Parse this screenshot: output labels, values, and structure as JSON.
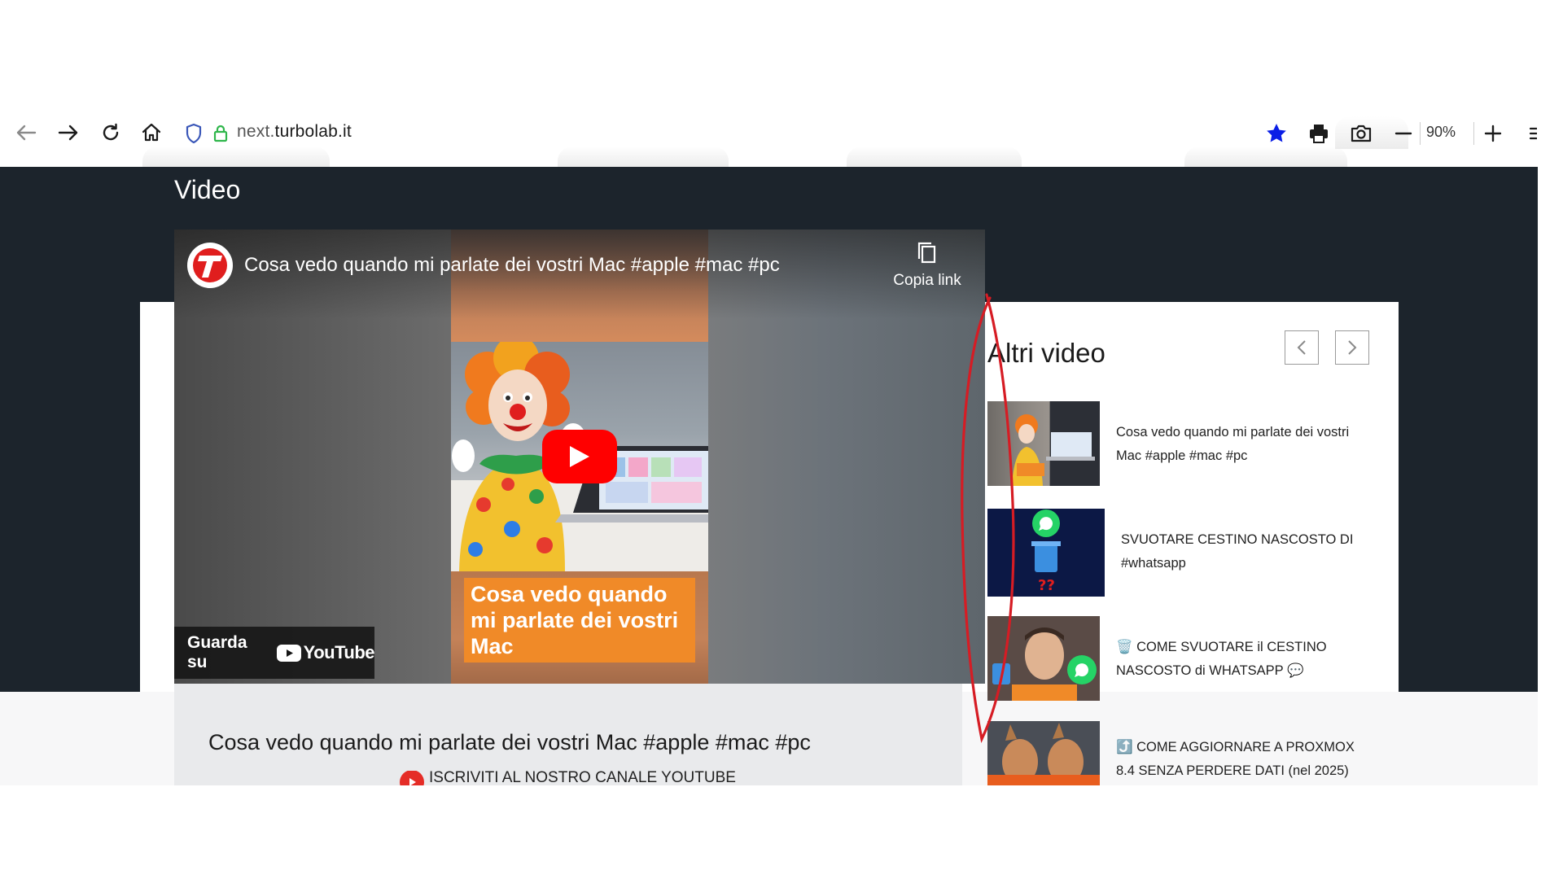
{
  "browser": {
    "url_sub": "next.",
    "url_domain": "turbolab.it",
    "zoom": "90%"
  },
  "page": {
    "section_heading": "Video",
    "player": {
      "title": "Cosa vedo quando mi parlate dei vostri Mac #apple #mac #pc",
      "copy_link_label": "Copia link",
      "thumbnail_caption": "Cosa vedo quando mi parlate dei vostri Mac",
      "watch_on_label": "Guarda su",
      "youtube_word": "YouTube"
    },
    "below_title": "Cosa vedo quando mi parlate dei vostri Mac #apple #mac #pc",
    "subscribe_text": "ISCRIVITI AL NOSTRO CANALE YOUTUBE",
    "sidebar": {
      "title": "Altri video",
      "items": [
        {
          "title": "Cosa vedo quando mi parlate dei vostri Mac #apple #mac #pc"
        },
        {
          "title": "SVUOTARE CESTINO NASCOSTO DI #whatsapp"
        },
        {
          "title": "🗑️ COME SVUOTARE il CESTINO NASCOSTO di WHATSAPP 💬"
        },
        {
          "title": "⤴️ COME AGGIORNARE A PROXMOX 8.4 SENZA PERDERE DATI (nel 2025)"
        }
      ]
    }
  },
  "colors": {
    "dark_band": "#1c242c",
    "youtube_red": "#ff0000",
    "caption_orange": "#f08a28",
    "annotation_red": "#d61c24",
    "bookmark_blue": "#0a1ee6"
  }
}
